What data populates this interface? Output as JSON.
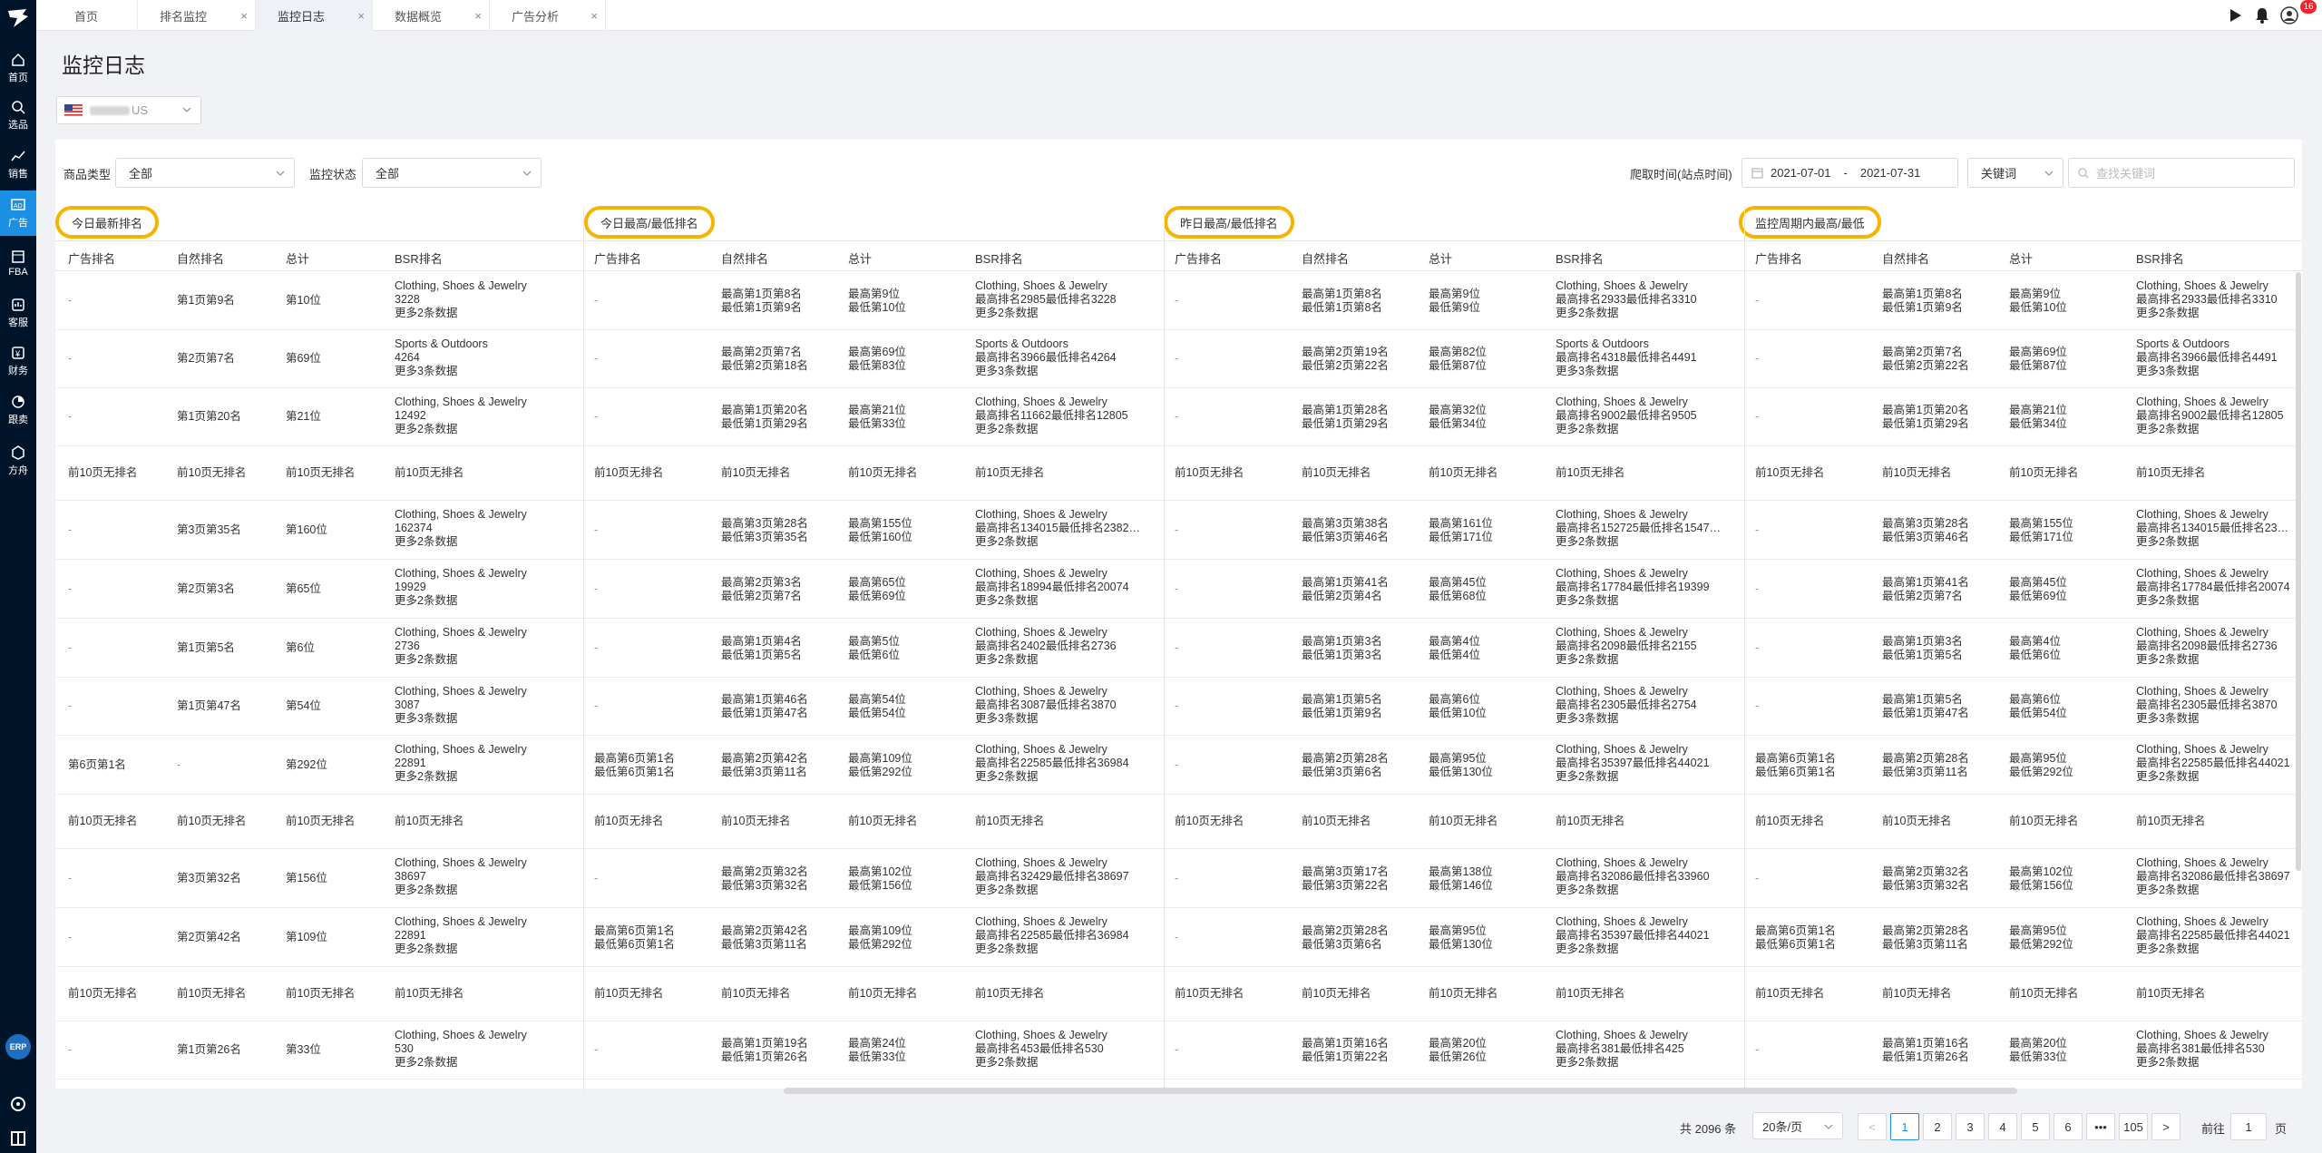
{
  "sidebar": {
    "items": [
      {
        "label": "首页",
        "icon": "home-icon"
      },
      {
        "label": "选品",
        "icon": "search-icon"
      },
      {
        "label": "销售",
        "icon": "trend-icon"
      },
      {
        "label": "广告",
        "icon": "ad-icon"
      },
      {
        "label": "FBA",
        "icon": "box-icon"
      },
      {
        "label": "客服",
        "icon": "service-icon"
      },
      {
        "label": "财务",
        "icon": "finance-icon"
      },
      {
        "label": "跟卖",
        "icon": "follow-icon"
      },
      {
        "label": "方舟",
        "icon": "ark-icon"
      }
    ],
    "erp": "ERP"
  },
  "tabs": [
    {
      "label": "首页",
      "closable": false
    },
    {
      "label": "排名监控",
      "closable": true
    },
    {
      "label": "监控日志",
      "closable": true,
      "active": true
    },
    {
      "label": "数据概览",
      "closable": true
    },
    {
      "label": "广告分析",
      "closable": true
    }
  ],
  "topbar": {
    "notif_count": "16"
  },
  "page": {
    "title": "监控日志",
    "store_suffix": "US"
  },
  "filters": {
    "category_label": "商品类型",
    "category_value": "全部",
    "status_label": "监控状态",
    "status_value": "全部",
    "date_label": "爬取时间(站点时间)",
    "date_start": "2021-07-01",
    "date_sep": "-",
    "date_end": "2021-07-31",
    "keyword_select": "关键词",
    "keyword_placeholder": "查找关键词"
  },
  "groups": [
    "今日最新排名",
    "今日最高/最低排名",
    "昨日最高/最低排名",
    "监控周期内最高/最低"
  ],
  "columns": [
    "广告排名",
    "自然排名",
    "总计",
    "BSR排名"
  ],
  "rows": [
    {
      "ad": "-",
      "nat": "第1页第9名",
      "tot": "第10位",
      "bsrCat": "Clothing, Shoes & Jewelry",
      "bsr": "3228",
      "more": "更多2条数据",
      "g": [
        {
          "ad": "-",
          "nat": [
            "最高第1页第8名",
            "最低第1页第9名"
          ],
          "tot": [
            "最高第9位",
            "最低第10位"
          ],
          "bsr": "最高排名2985最低排名3228",
          "more": "更多2条数据"
        },
        {
          "ad": "-",
          "nat": [
            "最高第1页第8名",
            "最低第1页第8名"
          ],
          "tot": [
            "最高第9位",
            "最低第9位"
          ],
          "bsr": "最高排名2933最低排名3310",
          "more": "更多2条数据"
        },
        {
          "ad": "-",
          "nat": [
            "最高第1页第8名",
            "最低第1页第9名"
          ],
          "tot": [
            "最高第9位",
            "最低第10位"
          ],
          "bsr": "最高排名2933最低排名3310",
          "more": "更多2条数据"
        }
      ]
    },
    {
      "ad": "-",
      "nat": "第2页第7名",
      "tot": "第69位",
      "bsrCat": "Sports & Outdoors",
      "bsr": "4264",
      "more": "更多3条数据",
      "g": [
        {
          "ad": "-",
          "nat": [
            "最高第2页第7名",
            "最低第2页第18名"
          ],
          "tot": [
            "最高第69位",
            "最低第83位"
          ],
          "bsrCat": "Sports & Outdoors",
          "bsr": "最高排名3966最低排名4264",
          "more": "更多3条数据"
        },
        {
          "ad": "-",
          "nat": [
            "最高第2页第19名",
            "最低第2页第22名"
          ],
          "tot": [
            "最高第82位",
            "最低第87位"
          ],
          "bsrCat": "Sports & Outdoors",
          "bsr": "最高排名4318最低排名4491",
          "more": "更多3条数据"
        },
        {
          "ad": "-",
          "nat": [
            "最高第2页第7名",
            "最低第2页第22名"
          ],
          "tot": [
            "最高第69位",
            "最低第87位"
          ],
          "bsrCat": "Sports & Outdoors",
          "bsr": "最高排名3966最低排名4491",
          "more": "更多3条数据"
        }
      ]
    },
    {
      "ad": "-",
      "nat": "第1页第20名",
      "tot": "第21位",
      "bsrCat": "Clothing, Shoes & Jewelry",
      "bsr": "12492",
      "more": "更多2条数据",
      "g": [
        {
          "ad": "-",
          "nat": [
            "最高第1页第20名",
            "最低第1页第29名"
          ],
          "tot": [
            "最高第21位",
            "最低第33位"
          ],
          "bsr": "最高排名11662最低排名12805",
          "more": "更多2条数据"
        },
        {
          "ad": "-",
          "nat": [
            "最高第1页第28名",
            "最低第1页第29名"
          ],
          "tot": [
            "最高第32位",
            "最低第34位"
          ],
          "bsr": "最高排名9002最低排名9505",
          "more": "更多2条数据"
        },
        {
          "ad": "-",
          "nat": [
            "最高第1页第20名",
            "最低第1页第29名"
          ],
          "tot": [
            "最高第21位",
            "最低第34位"
          ],
          "bsr": "最高排名9002最低排名12805",
          "more": "更多2条数据"
        }
      ]
    },
    {
      "none": "前10页无排名"
    },
    {
      "ad": "-",
      "nat": "第3页第35名",
      "tot": "第160位",
      "bsrCat": "Clothing, Shoes & Jewelry",
      "bsr": "162374",
      "more": "更多2条数据",
      "g": [
        {
          "ad": "-",
          "nat": [
            "最高第3页第28名",
            "最低第3页第35名"
          ],
          "tot": [
            "最高第155位",
            "最低第160位"
          ],
          "bsr": "最高排名134015最低排名2382…",
          "more": "更多2条数据"
        },
        {
          "ad": "-",
          "nat": [
            "最高第3页第38名",
            "最低第3页第46名"
          ],
          "tot": [
            "最高第161位",
            "最低第171位"
          ],
          "bsr": "最高排名152725最低排名1547…",
          "more": "更多2条数据"
        },
        {
          "ad": "-",
          "nat": [
            "最高第3页第28名",
            "最低第3页第46名"
          ],
          "tot": [
            "最高第155位",
            "最低第171位"
          ],
          "bsr": "最高排名134015最低排名2382…",
          "more": "更多2条数据"
        }
      ]
    },
    {
      "ad": "-",
      "nat": "第2页第3名",
      "tot": "第65位",
      "bsrCat": "Clothing, Shoes & Jewelry",
      "bsr": "19929",
      "more": "更多2条数据",
      "g": [
        {
          "ad": "-",
          "nat": [
            "最高第2页第3名",
            "最低第2页第7名"
          ],
          "tot": [
            "最高第65位",
            "最低第69位"
          ],
          "bsr": "最高排名18994最低排名20074",
          "more": "更多2条数据"
        },
        {
          "ad": "-",
          "nat": [
            "最高第1页第41名",
            "最低第2页第4名"
          ],
          "tot": [
            "最高第45位",
            "最低第68位"
          ],
          "bsr": "最高排名17784最低排名19399",
          "more": "更多2条数据"
        },
        {
          "ad": "-",
          "nat": [
            "最高第1页第41名",
            "最低第2页第7名"
          ],
          "tot": [
            "最高第45位",
            "最低第69位"
          ],
          "bsr": "最高排名17784最低排名20074",
          "more": "更多2条数据"
        }
      ]
    },
    {
      "ad": "-",
      "nat": "第1页第5名",
      "tot": "第6位",
      "bsrCat": "Clothing, Shoes & Jewelry",
      "bsr": "2736",
      "more": "更多2条数据",
      "g": [
        {
          "ad": "-",
          "nat": [
            "最高第1页第4名",
            "最低第1页第5名"
          ],
          "tot": [
            "最高第5位",
            "最低第6位"
          ],
          "bsr": "最高排名2402最低排名2736",
          "more": "更多2条数据"
        },
        {
          "ad": "-",
          "nat": [
            "最高第1页第3名",
            "最低第1页第3名"
          ],
          "tot": [
            "最高第4位",
            "最低第4位"
          ],
          "bsr": "最高排名2098最低排名2155",
          "more": "更多2条数据"
        },
        {
          "ad": "-",
          "nat": [
            "最高第1页第3名",
            "最低第1页第5名"
          ],
          "tot": [
            "最高第4位",
            "最低第6位"
          ],
          "bsr": "最高排名2098最低排名2736",
          "more": "更多2条数据"
        }
      ]
    },
    {
      "ad": "-",
      "nat": "第1页第47名",
      "tot": "第54位",
      "bsrCat": "Clothing, Shoes & Jewelry",
      "bsr": "3087",
      "more": "更多3条数据",
      "g": [
        {
          "ad": "-",
          "nat": [
            "最高第1页第46名",
            "最低第1页第47名"
          ],
          "tot": [
            "最高第54位",
            "最低第54位"
          ],
          "bsr": "最高排名3087最低排名3870",
          "more": "更多3条数据"
        },
        {
          "ad": "-",
          "nat": [
            "最高第1页第5名",
            "最低第1页第9名"
          ],
          "tot": [
            "最高第6位",
            "最低第10位"
          ],
          "bsr": "最高排名2305最低排名2754",
          "more": "更多3条数据"
        },
        {
          "ad": "-",
          "nat": [
            "最高第1页第5名",
            "最低第1页第47名"
          ],
          "tot": [
            "最高第6位",
            "最低第54位"
          ],
          "bsr": "最高排名2305最低排名3870",
          "more": "更多3条数据"
        }
      ]
    },
    {
      "ad": "第6页第1名",
      "nat": "-",
      "tot": "第292位",
      "bsrCat": "Clothing, Shoes & Jewelry",
      "bsr": "22891",
      "more": "更多2条数据",
      "g": [
        {
          "ad": [
            "最高第6页第1名",
            "最低第6页第1名"
          ],
          "nat": [
            "最高第2页第42名",
            "最低第3页第11名"
          ],
          "tot": [
            "最高第109位",
            "最低第292位"
          ],
          "bsr": "最高排名22585最低排名36984",
          "more": "更多2条数据"
        },
        {
          "ad": "-",
          "nat": [
            "最高第2页第28名",
            "最低第3页第6名"
          ],
          "tot": [
            "最高第95位",
            "最低第130位"
          ],
          "bsr": "最高排名35397最低排名44021",
          "more": "更多2条数据"
        },
        {
          "ad": [
            "最高第6页第1名",
            "最低第6页第1名"
          ],
          "nat": [
            "最高第2页第28名",
            "最低第3页第11名"
          ],
          "tot": [
            "最高第95位",
            "最低第292位"
          ],
          "bsr": "最高排名22585最低排名44021",
          "more": "更多2条数据"
        }
      ]
    },
    {
      "none": "前10页无排名"
    },
    {
      "ad": "-",
      "nat": "第3页第32名",
      "tot": "第156位",
      "bsrCat": "Clothing, Shoes & Jewelry",
      "bsr": "38697",
      "more": "更多2条数据",
      "g": [
        {
          "ad": "-",
          "nat": [
            "最高第2页第32名",
            "最低第3页第32名"
          ],
          "tot": [
            "最高第102位",
            "最低第156位"
          ],
          "bsr": "最高排名32429最低排名38697",
          "more": "更多2条数据"
        },
        {
          "ad": "-",
          "nat": [
            "最高第3页第17名",
            "最低第3页第22名"
          ],
          "tot": [
            "最高第138位",
            "最低第146位"
          ],
          "bsr": "最高排名32086最低排名33960",
          "more": "更多2条数据"
        },
        {
          "ad": "-",
          "nat": [
            "最高第2页第32名",
            "最低第3页第32名"
          ],
          "tot": [
            "最高第102位",
            "最低第156位"
          ],
          "bsr": "最高排名32086最低排名38697",
          "more": "更多2条数据"
        }
      ]
    },
    {
      "ad": "-",
      "nat": "第2页第42名",
      "tot": "第109位",
      "bsrCat": "Clothing, Shoes & Jewelry",
      "bsr": "22891",
      "more": "更多2条数据",
      "g": [
        {
          "ad": [
            "最高第6页第1名",
            "最低第6页第1名"
          ],
          "nat": [
            "最高第2页第42名",
            "最低第3页第11名"
          ],
          "tot": [
            "最高第109位",
            "最低第292位"
          ],
          "bsr": "最高排名22585最低排名36984",
          "more": "更多2条数据"
        },
        {
          "ad": "-",
          "nat": [
            "最高第2页第28名",
            "最低第3页第6名"
          ],
          "tot": [
            "最高第95位",
            "最低第130位"
          ],
          "bsr": "最高排名35397最低排名44021",
          "more": "更多2条数据"
        },
        {
          "ad": [
            "最高第6页第1名",
            "最低第6页第1名"
          ],
          "nat": [
            "最高第2页第28名",
            "最低第3页第11名"
          ],
          "tot": [
            "最高第95位",
            "最低第292位"
          ],
          "bsr": "最高排名22585最低排名44021",
          "more": "更多2条数据"
        }
      ]
    },
    {
      "none": "前10页无排名"
    },
    {
      "ad": "-",
      "nat": "第1页第26名",
      "tot": "第33位",
      "bsrCat": "Clothing, Shoes & Jewelry",
      "bsr": "530",
      "more": "更多2条数据",
      "g": [
        {
          "ad": "-",
          "nat": [
            "最高第1页第19名",
            "最低第1页第26名"
          ],
          "tot": [
            "最高第24位",
            "最低第33位"
          ],
          "bsr": "最高排名453最低排名530",
          "more": "更多2条数据"
        },
        {
          "ad": "-",
          "nat": [
            "最高第1页第16名",
            "最低第1页第22名"
          ],
          "tot": [
            "最高第20位",
            "最低第26位"
          ],
          "bsr": "最高排名381最低排名425",
          "more": "更多2条数据"
        },
        {
          "ad": "-",
          "nat": [
            "最高第1页第16名",
            "最低第1页第26名"
          ],
          "tot": [
            "最高第20位",
            "最低第33位"
          ],
          "bsr": "最高排名381最低排名530",
          "more": "更多2条数据"
        }
      ]
    }
  ],
  "pagination": {
    "total": "共 2096 条",
    "page_size": "20条/页",
    "prev": "<",
    "next": ">",
    "pages": [
      "1",
      "2",
      "3",
      "4",
      "5",
      "6",
      "•••",
      "105"
    ],
    "current": "1",
    "goto_label": "前往",
    "goto_value": "1",
    "goto_suffix": "页"
  }
}
